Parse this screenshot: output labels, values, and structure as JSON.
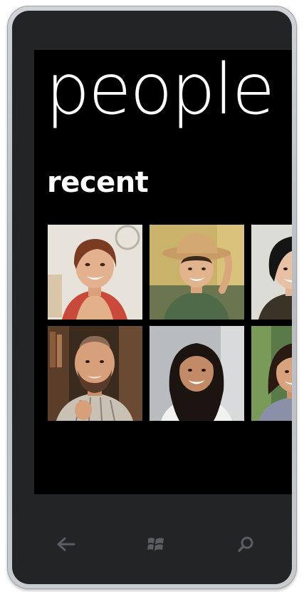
{
  "app": {
    "title": "people",
    "section": "recent"
  },
  "contacts": [
    {
      "photo": "woman-short-red-hair"
    },
    {
      "photo": "woman-cowboy-hat"
    },
    {
      "photo": "woman-black-hair"
    },
    {
      "photo": "bearded-man"
    },
    {
      "photo": "woman-long-dark-hair"
    },
    {
      "photo": "woman-smiling"
    }
  ],
  "navigation": {
    "back": "back-arrow-icon",
    "start": "windows-logo-icon",
    "search": "search-icon"
  },
  "colors": {
    "screen_background": "#000000",
    "text": "#ffffff",
    "bezel": "#222426",
    "nav_icon": "#5a5d61"
  }
}
